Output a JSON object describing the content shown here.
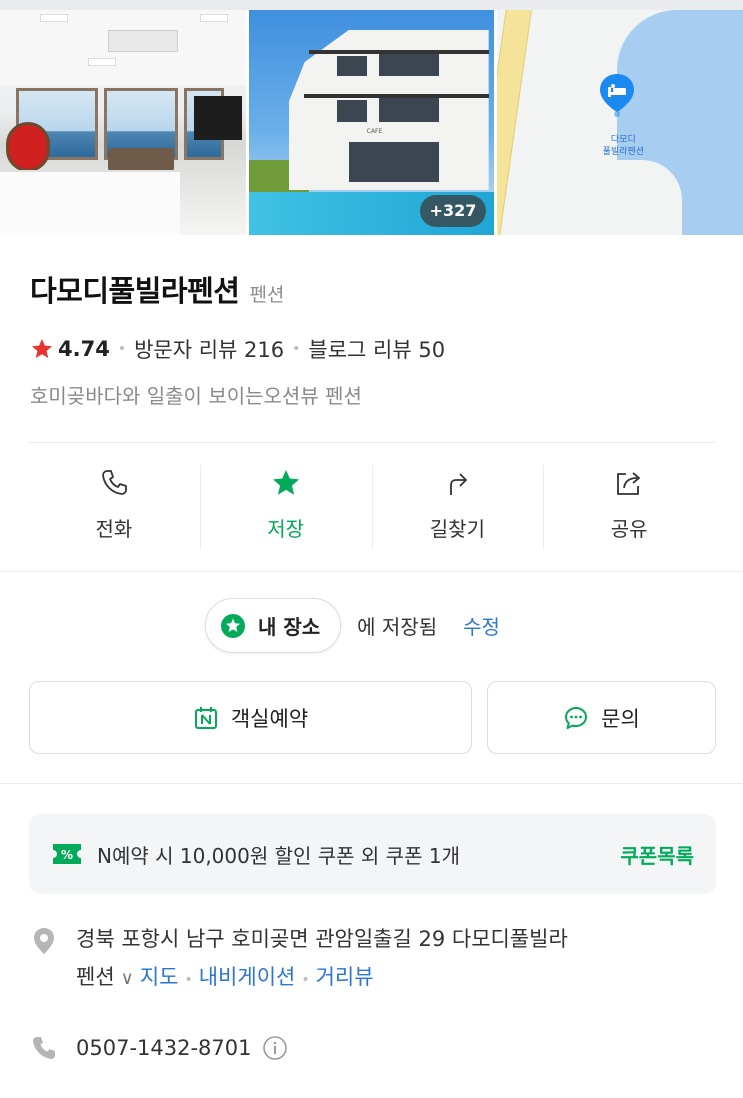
{
  "photos": {
    "more_count": "+327",
    "interior_cafe_sign": "CAFE",
    "map_label_line1": "다모디",
    "map_label_line2": "풀빌라펜션"
  },
  "place": {
    "name": "다모디풀빌라펜션",
    "category": "펜션",
    "rating": "4.74",
    "visitor_reviews": "방문자 리뷰 216",
    "blog_reviews": "블로그 리뷰 50",
    "description": "호미곶바다와 일출이 보이는오션뷰 펜션"
  },
  "actions": [
    {
      "label": "전화",
      "icon": "phone-icon"
    },
    {
      "label": "저장",
      "icon": "star-icon"
    },
    {
      "label": "길찾기",
      "icon": "directions-icon"
    },
    {
      "label": "공유",
      "icon": "share-icon"
    }
  ],
  "saved": {
    "chip_label": "내 장소",
    "status_text": "에 저장됨",
    "edit_label": "수정"
  },
  "buttons": {
    "reserve_label": "객실예약",
    "inquiry_label": "문의"
  },
  "coupon": {
    "text": "N예약 시 10,000원 할인 쿠폰 외 쿠폰 1개",
    "link_label": "쿠폰목록"
  },
  "address": {
    "line": "경북 포항시 남구 호미곶면 관암일출길 29 다모디풀빌라",
    "line2": "펜션",
    "map_link": "지도",
    "nav_link": "내비게이션",
    "street_link": "거리뷰"
  },
  "phone": {
    "number": "0507-1432-8701"
  },
  "colors": {
    "accent_green": "#03aa5a",
    "link_blue": "#2a76d2",
    "rating_red": "#e8322f"
  }
}
